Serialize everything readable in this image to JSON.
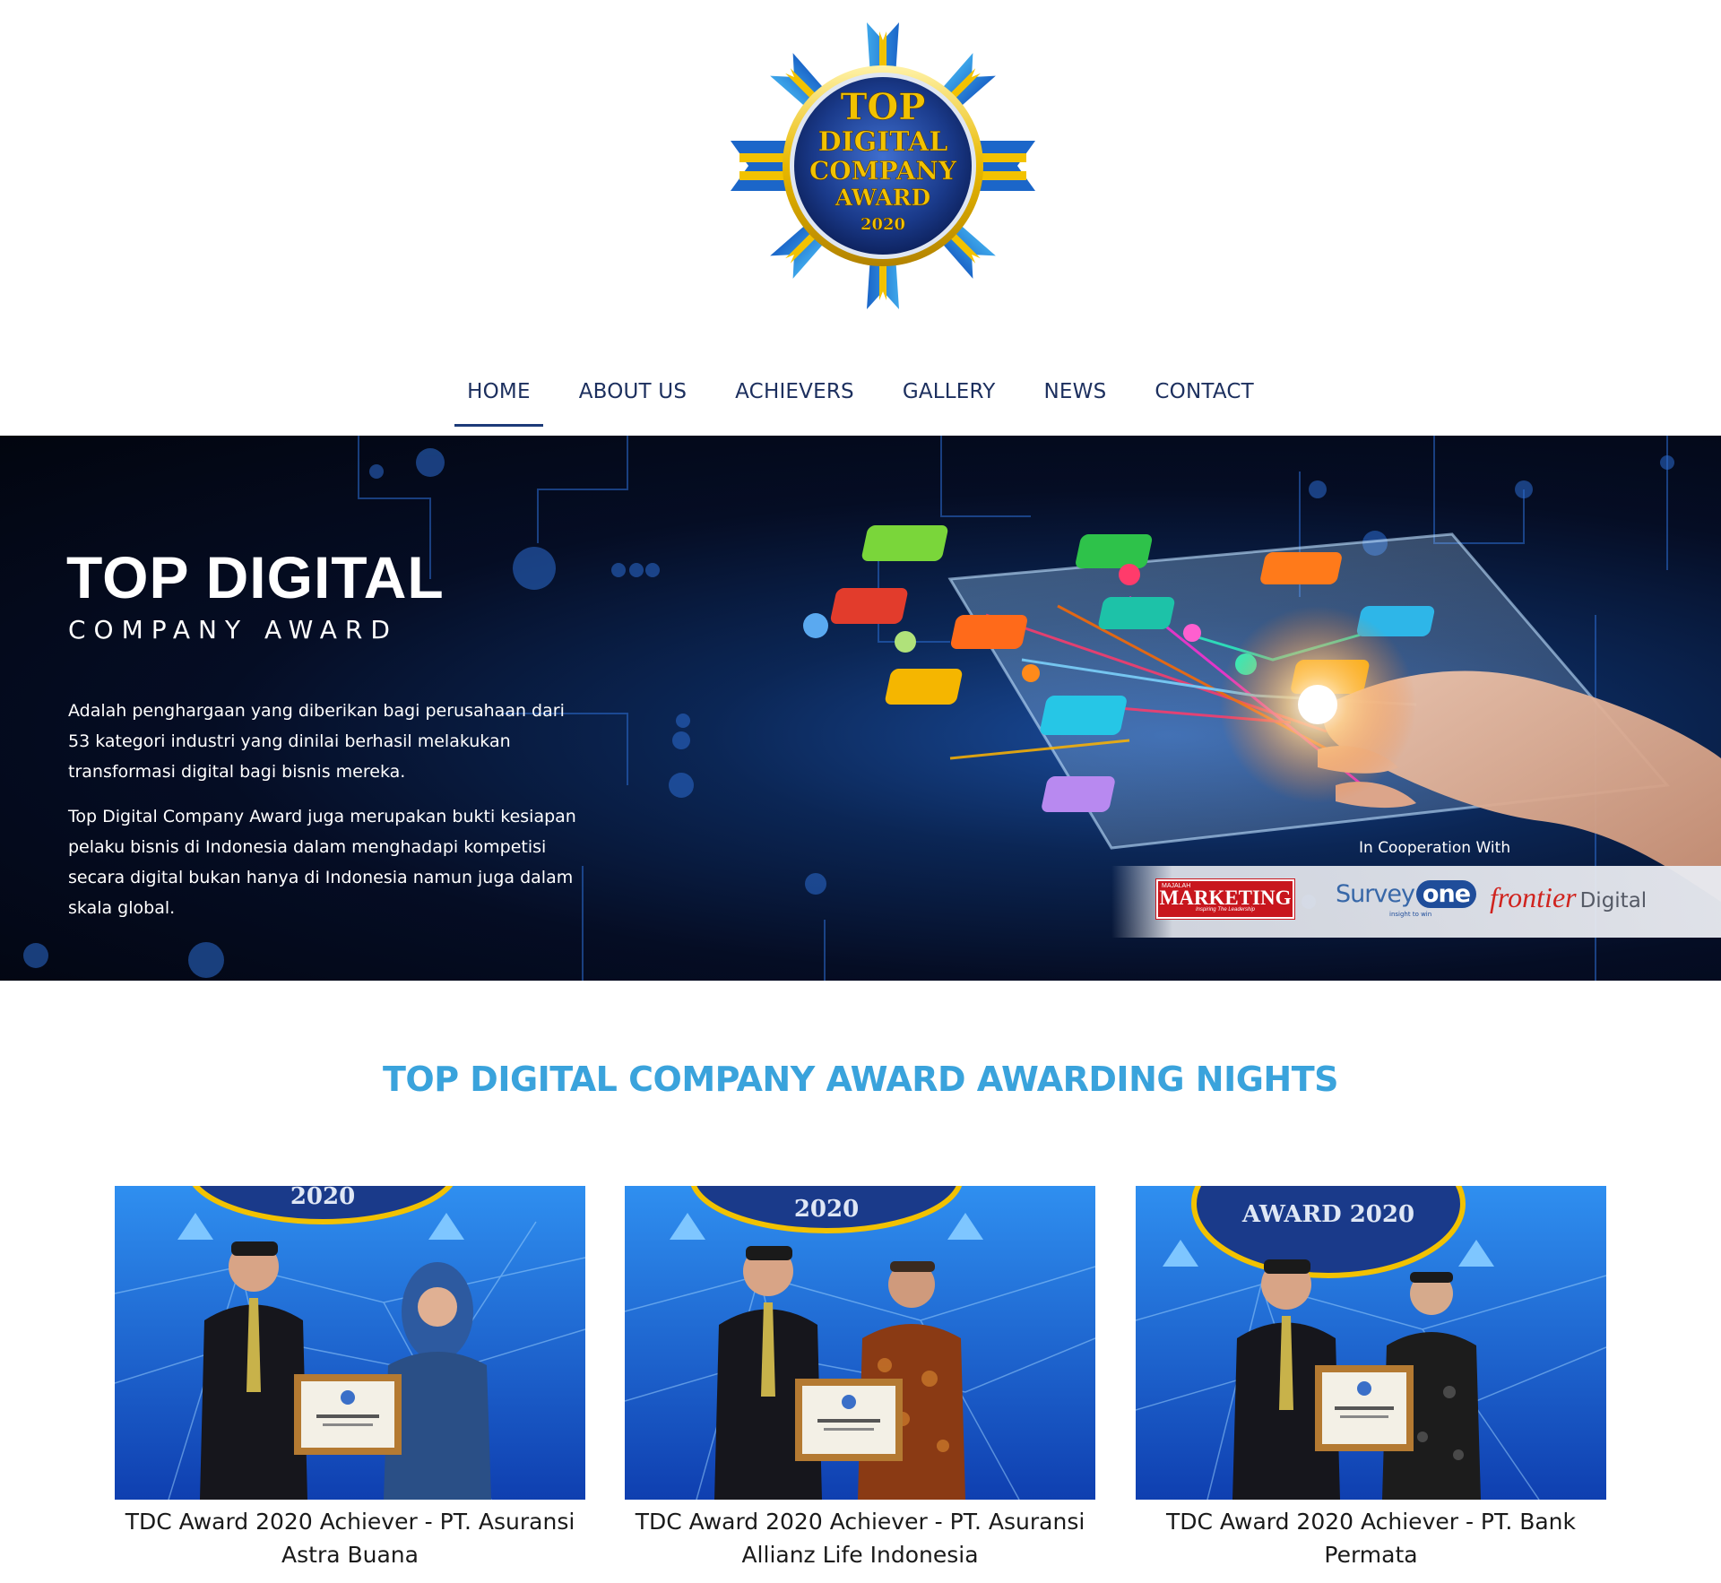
{
  "logo": {
    "line1": "TOP",
    "line2": "DIGITAL",
    "line3": "COMPANY",
    "line4": "AWARD",
    "year": "2020"
  },
  "nav": {
    "items": [
      {
        "label": "HOME",
        "active": true
      },
      {
        "label": "ABOUT US",
        "active": false
      },
      {
        "label": "ACHIEVERS",
        "active": false
      },
      {
        "label": "GALLERY",
        "active": false
      },
      {
        "label": "NEWS",
        "active": false
      },
      {
        "label": "CONTACT",
        "active": false
      }
    ]
  },
  "hero": {
    "title": "TOP DIGITAL",
    "subtitle": "COMPANY AWARD",
    "paragraph1": "Adalah penghargaan yang diberikan bagi perusahaan dari 53 kategori industri yang dinilai berhasil melakukan transformasi digital bagi bisnis mereka.",
    "paragraph2": "Top Digital Company Award juga merupakan bukti kesiapan pelaku bisnis di Indonesia dalam menghadapi kompetisi secara digital bukan hanya di Indonesia namun juga dalam skala global.",
    "cooperation_label": "In Cooperation With",
    "partners": {
      "marketing_small": "MAJALAH",
      "marketing": "MARKETING",
      "marketing_tag": "Inspiring The Leadership",
      "surveyone_survey": "Survey",
      "surveyone_one": "one",
      "surveyone_tag": "insight to win",
      "frontier": "frontier",
      "frontier_digital": "Digital"
    }
  },
  "section": {
    "title": "TOP DIGITAL COMPANY AWARD AWARDING NIGHTS"
  },
  "cards": [
    {
      "caption": "TDC Award 2020 Achiever - PT. Asuransi Astra Buana",
      "backdrop_text": "2020"
    },
    {
      "caption": "TDC Award 2020 Achiever - PT. Asuransi Allianz Life Indonesia",
      "backdrop_text": "2020"
    },
    {
      "caption": "TDC Award 2020 Achiever - PT. Bank Permata",
      "backdrop_text": "AWARD 2020"
    }
  ],
  "colors": {
    "nav_text": "#1c2f5e",
    "section_title": "#3aa3dc",
    "logo_gold": "#f2c200",
    "logo_blue": "#1a3a8a"
  }
}
